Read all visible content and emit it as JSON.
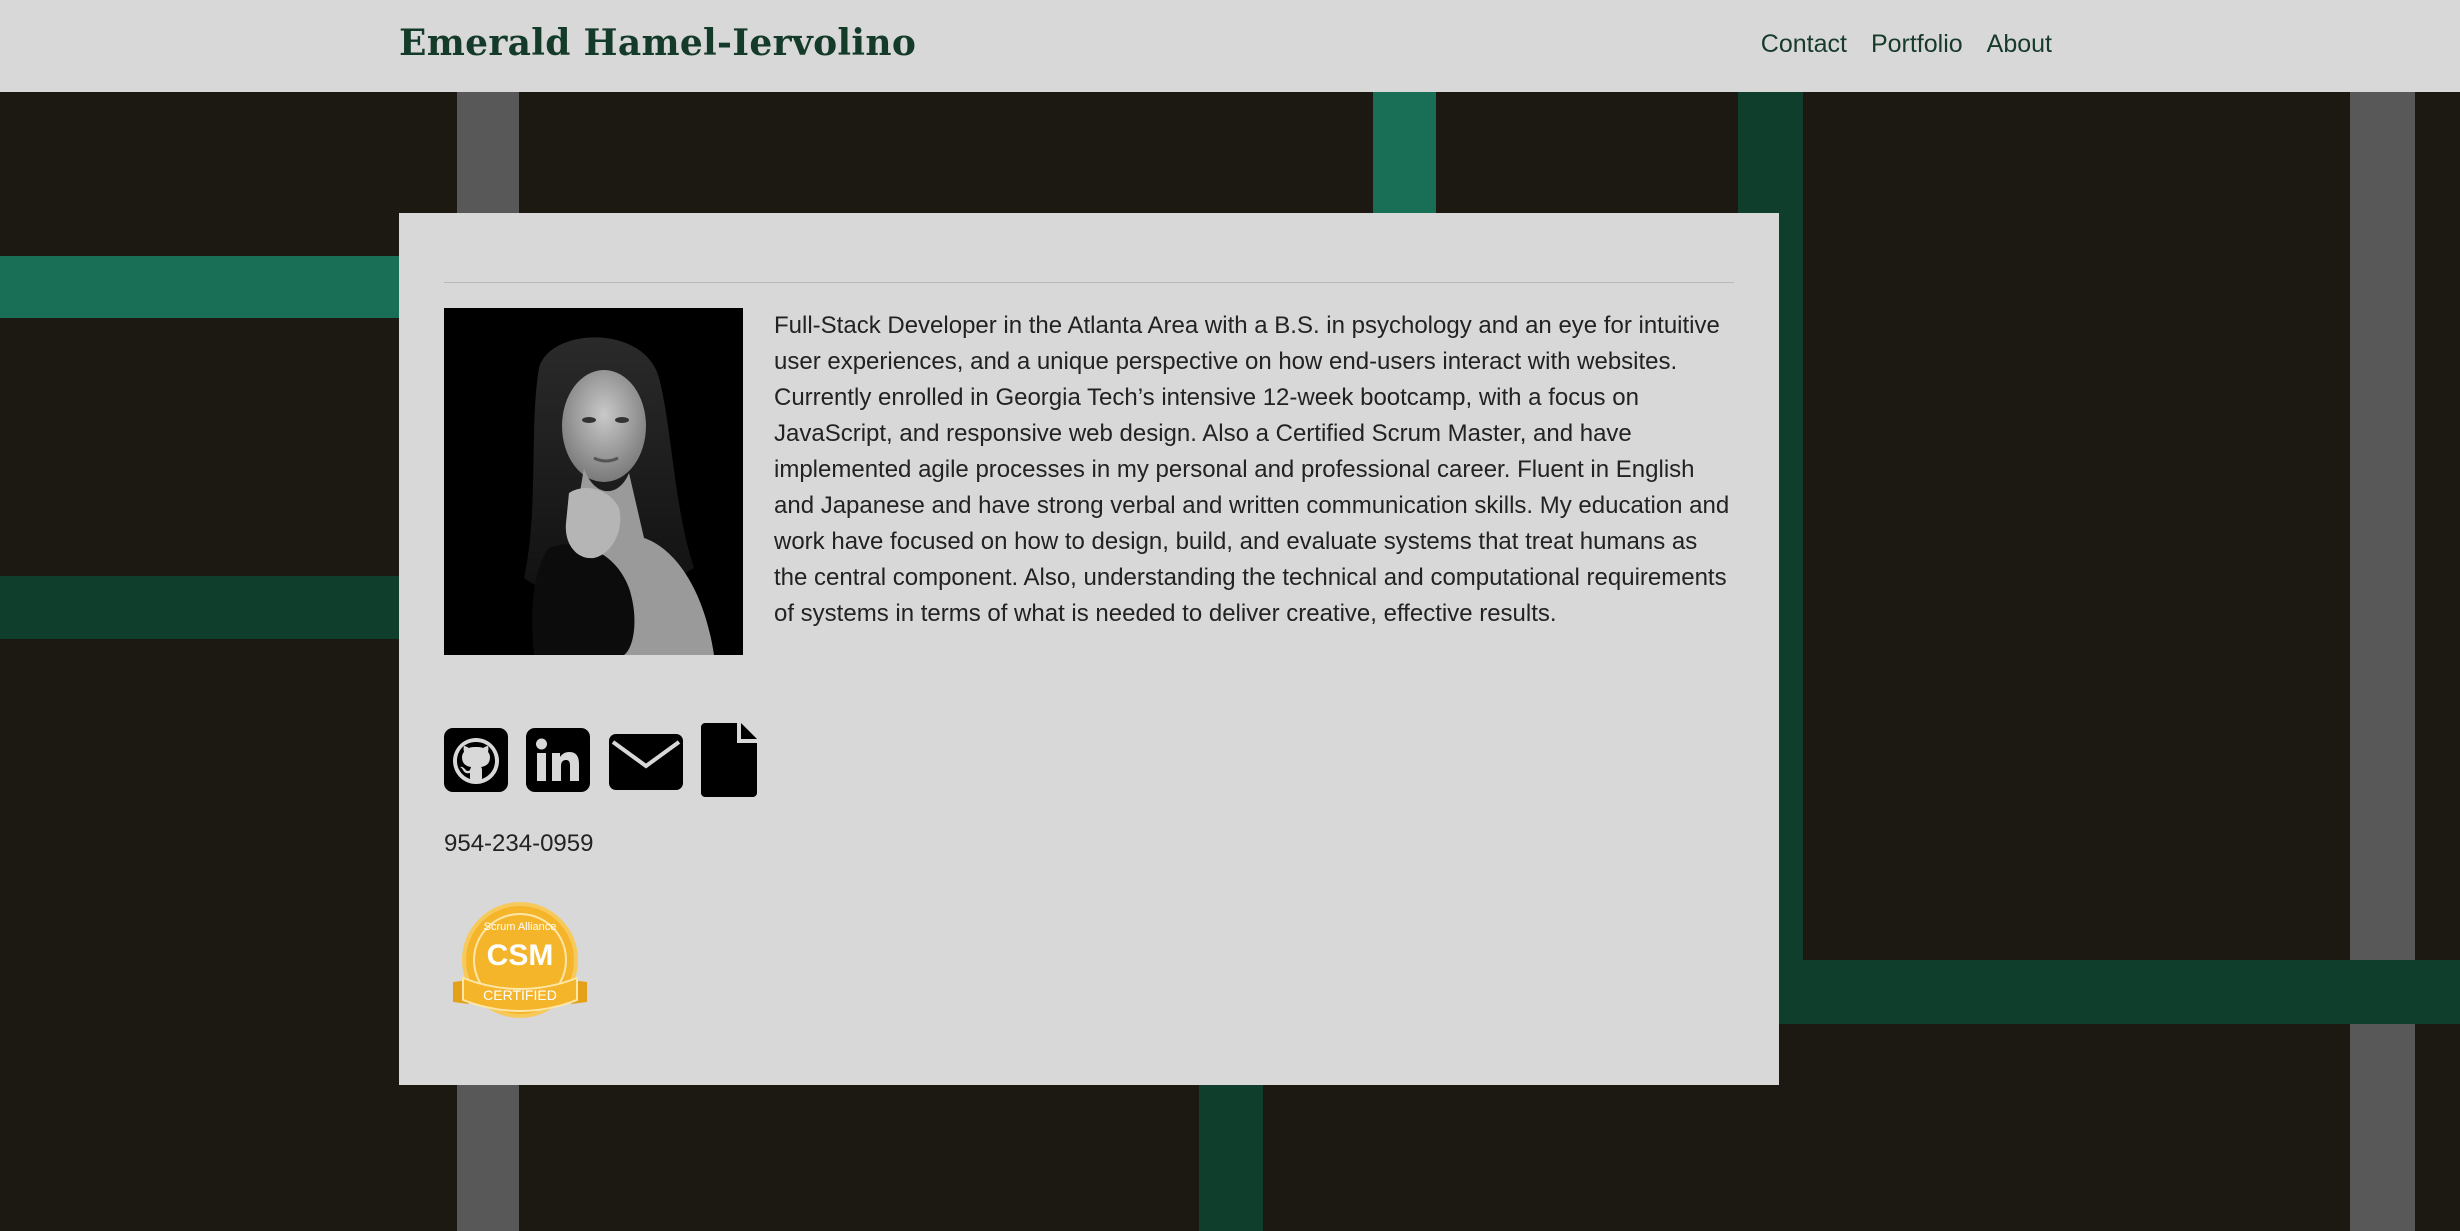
{
  "header": {
    "brand": "Emerald Hamel-Iervolino",
    "nav": [
      "Contact",
      "Portfolio",
      "About"
    ]
  },
  "about": {
    "bio": "Full-Stack Developer in the Atlanta Area with a B.S. in psychology and an eye for intuitive user experiences, and a unique perspective on how end-users interact with websites. Currently enrolled in Georgia Tech’s intensive 12-week bootcamp, with a focus on JavaScript, and responsive web design. Also a Certified Scrum Master, and have implemented agile processes in my personal and professional career. Fluent in English and Japanese and have strong verbal and written communication skills. My education and work have focused on how to design, build, and evaluate systems that treat humans as the central component. Also, understanding the technical and computational requirements of systems in terms of what is needed to deliver creative, effective results.",
    "phone": "954-234-0959",
    "badge": {
      "main": "CSM",
      "ribbon": "CERTIFIED",
      "arc": "Scrum Alliance"
    }
  },
  "icons": [
    "github-icon",
    "linkedin-icon",
    "email-icon",
    "resume-file-icon"
  ],
  "colors": {
    "header_bg": "#d8d8d8",
    "page_bg": "#1c1812",
    "brand_green": "#143a2a",
    "stripe_green_light": "#186f55",
    "stripe_green_dark": "#0f3f2c",
    "stripe_gray": "#585858",
    "badge_gold": "#f5b52b"
  }
}
